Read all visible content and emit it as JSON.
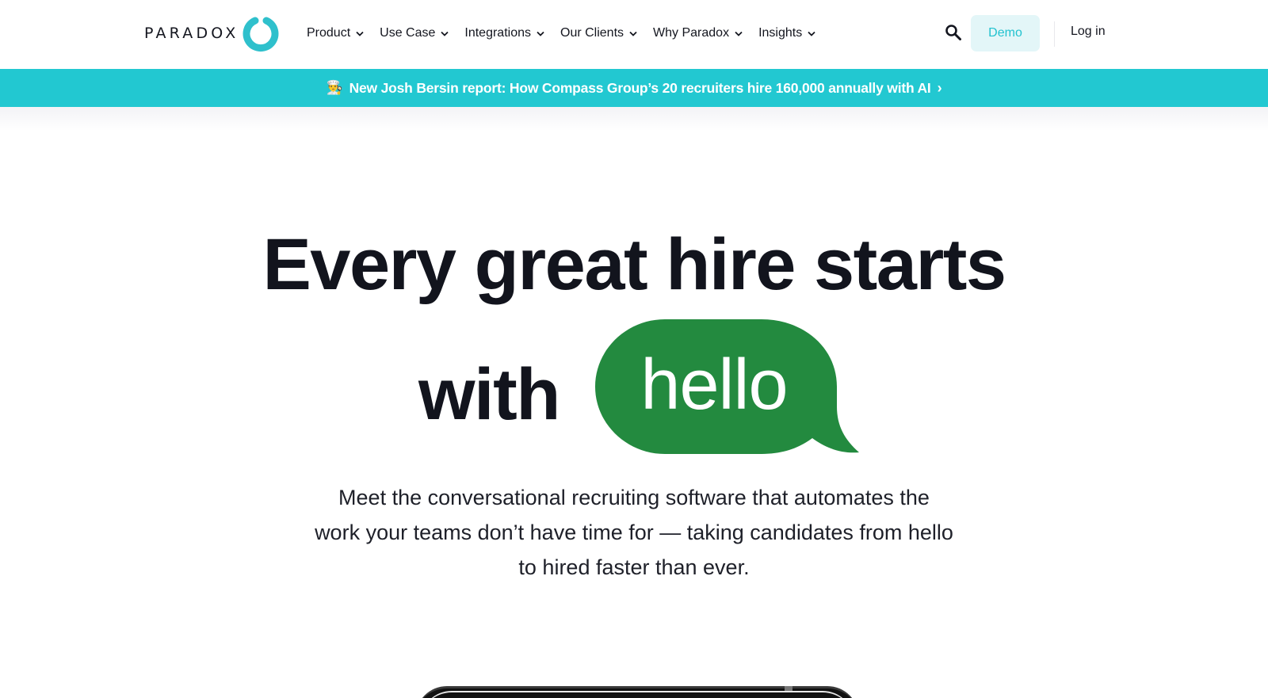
{
  "brand": {
    "name": "PARADOX",
    "accent": "#22c8d1",
    "bubble_color": "#238a3f"
  },
  "nav": {
    "items": [
      {
        "label": "Product"
      },
      {
        "label": "Use Case"
      },
      {
        "label": "Integrations"
      },
      {
        "label": "Our Clients"
      },
      {
        "label": "Why Paradox"
      },
      {
        "label": "Insights"
      }
    ],
    "search_icon": "search-icon",
    "demo_label": "Demo",
    "login_label": "Log in"
  },
  "banner": {
    "emoji": "👨‍🍳",
    "text": "New Josh Bersin report: How Compass Group’s 20 recruiters hire 160,000 annually with AI",
    "arrow": "›"
  },
  "hero": {
    "title_line1": "Every great hire starts",
    "title_with": "with",
    "bubble_word": "hello",
    "subtitle_lines": [
      "Meet the conversational recruiting software that automates the",
      "work your teams don’t have time for — taking candidates from hello",
      "to hired faster than ever."
    ]
  }
}
